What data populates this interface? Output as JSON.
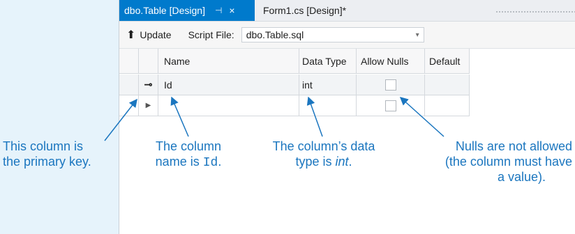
{
  "tabs": {
    "active_label": "dbo.Table [Design]",
    "active_pin": "⊣",
    "active_close": "×",
    "inactive_label": "Form1.cs [Design]*"
  },
  "toolbar": {
    "update_label": "Update",
    "update_icon": "⬆",
    "script_file_label": "Script File:",
    "script_file_value": "dbo.Table.sql",
    "script_file_arrow": "▾"
  },
  "grid": {
    "headers": [
      "Name",
      "Data Type",
      "Allow Nulls",
      "Default"
    ],
    "rows": [
      {
        "is_key": true,
        "key_icon": "⊸",
        "name": "Id",
        "data_type": "int",
        "allow_nulls": false
      },
      {
        "is_key": false,
        "new_row_marker": "▶",
        "name": "",
        "data_type": "",
        "allow_nulls": false
      }
    ]
  },
  "annotations": {
    "pk": {
      "line1": "This column is",
      "line2": "the primary key."
    },
    "name": {
      "line1": "The column",
      "prefix": "name is ",
      "code": "Id",
      "suffix": "."
    },
    "type": {
      "line1": "The column’s data",
      "prefix": "type is ",
      "italic": "int",
      "suffix": "."
    },
    "nulls": {
      "line1": "Nulls are not allowed",
      "line2": "(the column must have",
      "line3": "a value)."
    }
  },
  "colors": {
    "accent": "#007acc",
    "annotation": "#1b76bf",
    "background": "#e6f3fb"
  }
}
